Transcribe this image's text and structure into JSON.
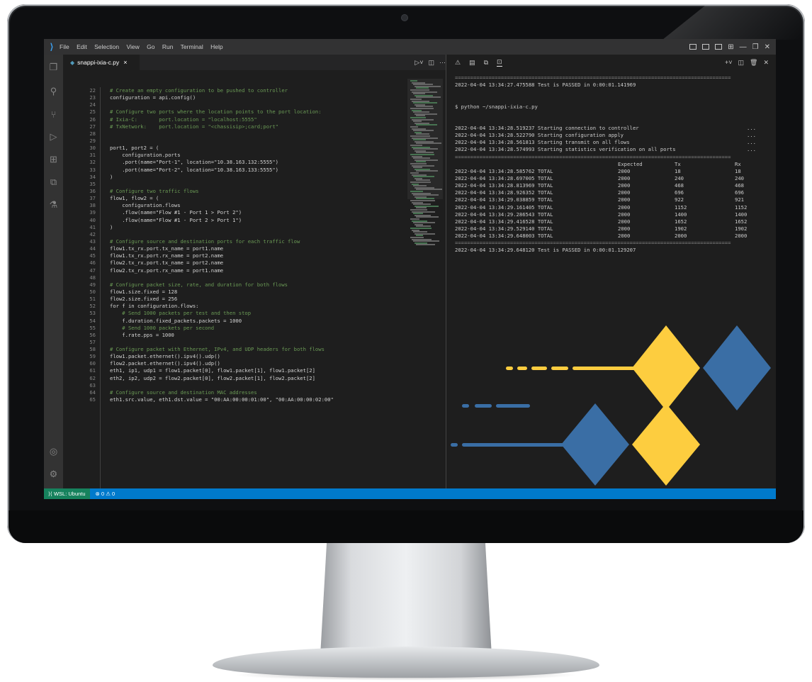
{
  "titlebar": {
    "menu": [
      "File",
      "Edit",
      "Selection",
      "View",
      "Go",
      "Run",
      "Terminal",
      "Help"
    ]
  },
  "tab": {
    "filename": "snappi-ixia-c.py",
    "close": "×"
  },
  "editor": {
    "line_numbers": [
      "22",
      "23",
      "24",
      "25",
      "26",
      "27",
      "28",
      "29",
      "30",
      "31",
      "32",
      "33",
      "34",
      "35",
      "36",
      "37",
      "38",
      "39",
      "40",
      "41",
      "42",
      "43",
      "44",
      "45",
      "46",
      "47",
      "48",
      "49",
      "50",
      "51",
      "52",
      "53",
      "54",
      "55",
      "56",
      "57",
      "58",
      "59",
      "60",
      "61",
      "62",
      "63",
      "64",
      "65"
    ],
    "lines": [
      "# Create an empty configuration to be pushed to controller",
      "configuration = api.config()",
      "",
      "# Configure two ports where the location points to the port location:",
      "# Ixia-C:       port.location = \"localhost:5555\"",
      "# TxNetwork:    port.location = \"<chassisip>;card;port\"",
      "",
      "",
      "port1, port2 = (",
      "    configuration.ports",
      "    .port(name=\"Port-1\", location=\"10.38.163.132:5555\")",
      "    .port(name=\"Port-2\", location=\"10.38.163.133:5555\")",
      ")",
      "",
      "# Configure two traffic flows",
      "flow1, flow2 = (",
      "    configuration.flows",
      "    .flow(name=\"Flow #1 - Port 1 > Port 2\")",
      "    .flow(name=\"Flow #1 - Port 2 > Port 1\")",
      ")",
      "",
      "# Configure source and destination ports for each traffic flow",
      "flow1.tx_rx.port.tx_name = port1.name",
      "flow1.tx_rx.port.rx_name = port2.name",
      "flow2.tx_rx.port.tx_name = port2.name",
      "flow2.tx_rx.port.rx_name = port1.name",
      "",
      "# Configure packet size, rate, and duration for both flows",
      "flow1.size.fixed = 128",
      "flow2.size.fixed = 256",
      "for f in configuration.flows:",
      "    # Send 1000 packets per test and then stop",
      "    f.duration.fixed_packets.packets = 1000",
      "    # Send 1000 packets per second",
      "    f.rate.pps = 1000",
      "",
      "# Configure packet with Ethernet, IPv4, and UDP headers for both flows",
      "flow1.packet.ethernet().ipv4().udp()",
      "flow2.packet.ethernet().ipv4().udp()",
      "eth1, ip1, udp1 = flow1.packet[0], flow1.packet[1], flow1.packet[2]",
      "eth2, ip2, udp2 = flow2.packet[0], flow2.packet[1], flow2.packet[2]",
      "",
      "# Configure source and destination MAC addresses",
      "eth1.src.value, eth1.dst.value = \"00:AA:00:00:01:00\", \"00:AA:00:00:02:00\""
    ]
  },
  "terminal": {
    "separator": "==========================================================================================",
    "first_result": "2022-04-04 13:34:27.475588 Test is PASSED in 0:00:01.141969",
    "command": "$ python ~/snappi-ixia-c.py",
    "steps": [
      {
        "text": "2022-04-04 13:34:28.519237 Starting connection to controller",
        "dots": "..."
      },
      {
        "text": "2022-04-04 13:34:28.522790 Starting configuration apply",
        "dots": "..."
      },
      {
        "text": "2022-04-04 13:34:28.561813 Starting transmit on all flows",
        "dots": "..."
      },
      {
        "text": "2022-04-04 13:34:28.574993 Starting statistics verification on all ports",
        "dots": "..."
      }
    ],
    "headers": {
      "expected": "Expected",
      "tx": "Tx",
      "rx": "Rx"
    },
    "rows": [
      {
        "time": "2022-04-04 13:34:28.585762 TOTAL",
        "expected": "2000",
        "tx": "18",
        "rx": "18"
      },
      {
        "time": "2022-04-04 13:34:28.697005 TOTAL",
        "expected": "2000",
        "tx": "240",
        "rx": "240"
      },
      {
        "time": "2022-04-04 13:34:28.813969 TOTAL",
        "expected": "2000",
        "tx": "468",
        "rx": "468"
      },
      {
        "time": "2022-04-04 13:34:28.926352 TOTAL",
        "expected": "2000",
        "tx": "696",
        "rx": "696"
      },
      {
        "time": "2022-04-04 13:34:29.038859 TOTAL",
        "expected": "2000",
        "tx": "922",
        "rx": "921"
      },
      {
        "time": "2022-04-04 13:34:29.161405 TOTAL",
        "expected": "2000",
        "tx": "1152",
        "rx": "1152"
      },
      {
        "time": "2022-04-04 13:34:29.286543 TOTAL",
        "expected": "2000",
        "tx": "1400",
        "rx": "1400"
      },
      {
        "time": "2022-04-04 13:34:29.416528 TOTAL",
        "expected": "2000",
        "tx": "1652",
        "rx": "1652"
      },
      {
        "time": "2022-04-04 13:34:29.529140 TOTAL",
        "expected": "2000",
        "tx": "1902",
        "rx": "1902"
      },
      {
        "time": "2022-04-04 13:34:29.648003 TOTAL",
        "expected": "2000",
        "tx": "2000",
        "rx": "2000"
      }
    ],
    "final_result": "2022-04-04 13:34:29.648120 Test is PASSED in 0:00:01.129207"
  },
  "statusbar": {
    "remote": "WSL: Ubuntu",
    "errors": "0",
    "warnings": "0"
  },
  "colors": {
    "accent": "#007acc",
    "remote": "#16825d",
    "yellow": "#fdcd3f",
    "blue": "#3a6ea5"
  }
}
